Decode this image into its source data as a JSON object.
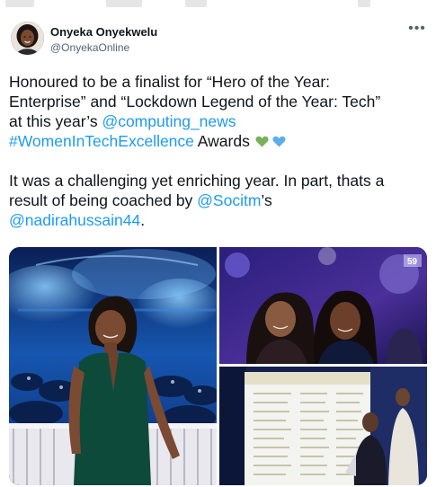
{
  "author": {
    "name": "Onyeka Onyekwelu",
    "handle": "@OnyekaOnline",
    "avatar_icon": "avatar-photo"
  },
  "menu_icon": "more-dots-icon",
  "tweet": {
    "line1": "Honoured to be a finalist for “Hero of the Year:",
    "line2": "Enterprise” and “Lockdown Legend of the Year: Tech”",
    "line3_prefix": "at this year’s ",
    "mention_computing": "@computing_news",
    "hashtag": "#WomenInTechExcellence",
    "line4_suffix": " Awards",
    "line5": "It was a challenging yet enriching year. In part, thats a",
    "line6_prefix": "result of being coached by ",
    "mention_socitm": "@Socitm",
    "line6_suffix": "’s",
    "mention_nadira": "@nadirahussain44",
    "line7_suffix": ".",
    "emoji": [
      "green-heart-icon",
      "blue-heart-icon"
    ]
  },
  "photos": {
    "photo1": "awards-gala-portrait",
    "photo2": "two-women-selfie",
    "photo3": "finalist-board-photo",
    "photo2_badge": "59"
  },
  "colors": {
    "link": "#1d9bf0",
    "text": "#0f1419",
    "secondary": "#536471",
    "green_heart": "#78b159",
    "blue_heart": "#5dadec"
  }
}
